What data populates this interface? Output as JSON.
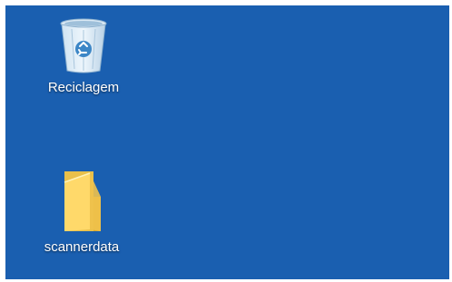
{
  "desktop": {
    "background_color": "#1a5fb0",
    "icons": [
      {
        "label": "Reciclagem",
        "icon": "recycle-bin-icon"
      },
      {
        "label": "scannerdata",
        "icon": "folder-icon"
      }
    ]
  }
}
